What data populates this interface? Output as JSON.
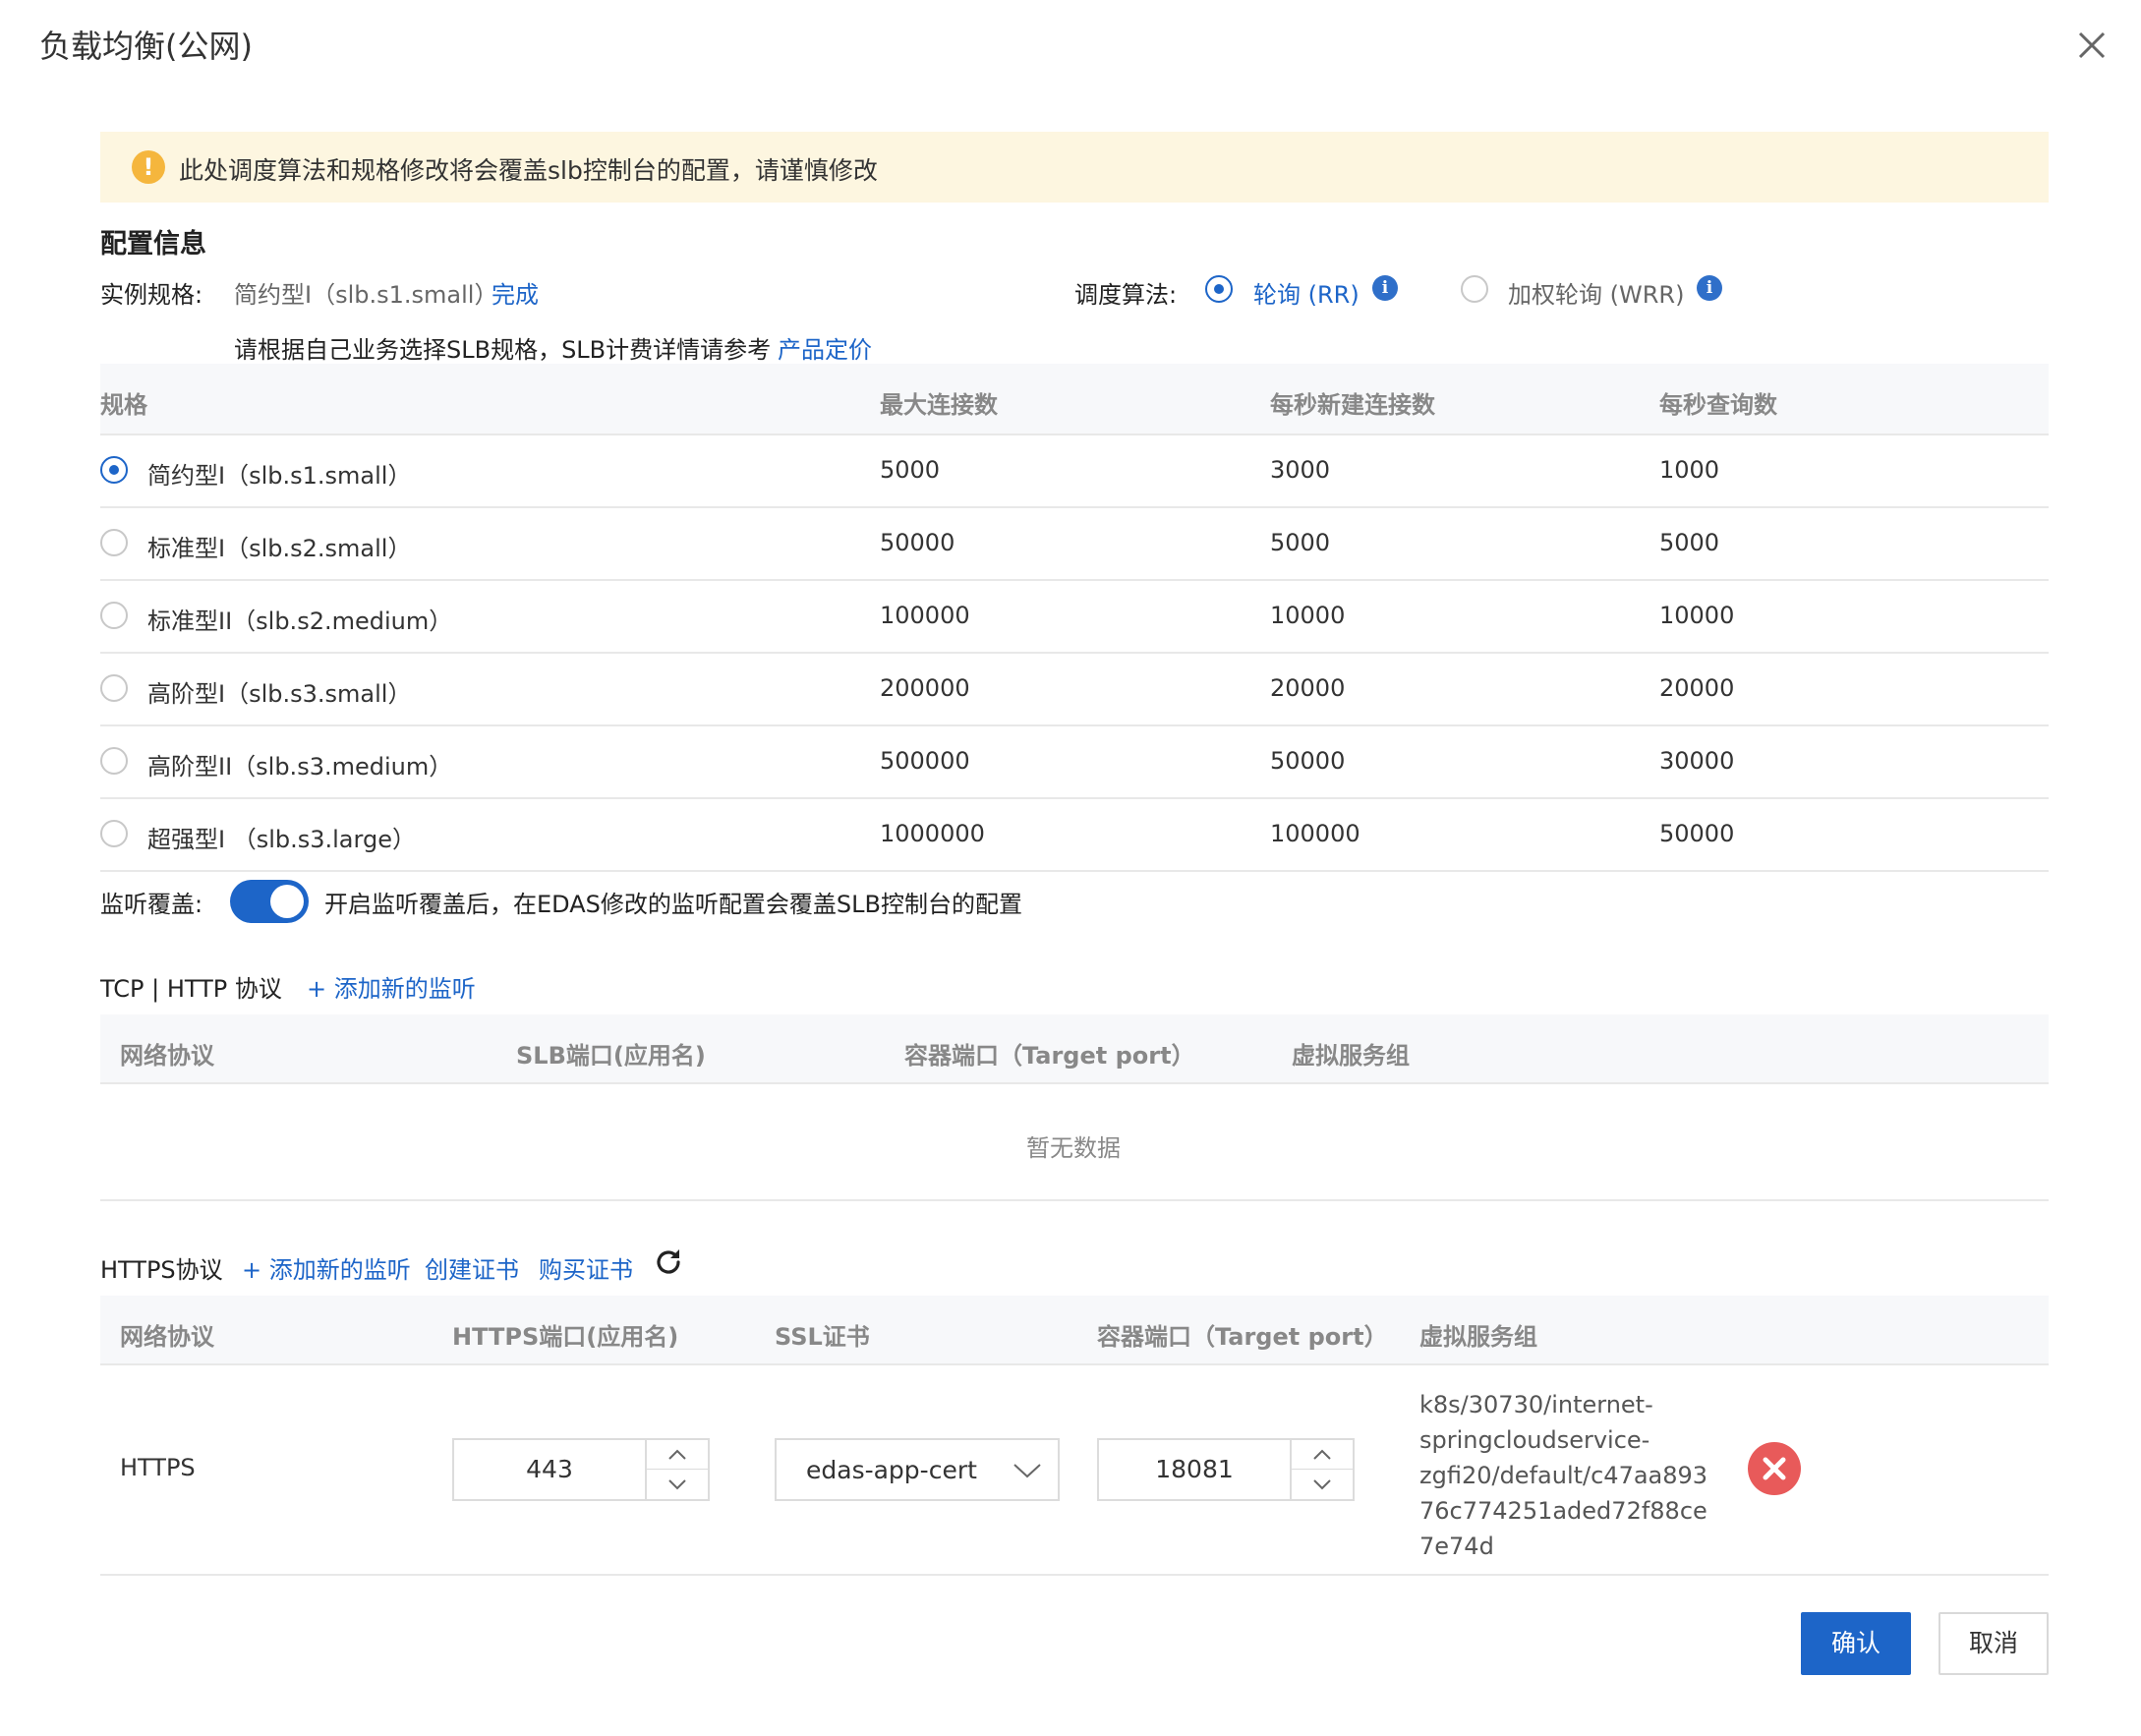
{
  "dialog": {
    "title": "负载均衡(公网)"
  },
  "warning": {
    "text": "此处调度算法和规格修改将会覆盖slb控制台的配置，请谨慎修改",
    "icon": "exclamation-icon"
  },
  "config": {
    "section_title": "配置信息",
    "spec_label": "实例规格:",
    "spec_value": "简约型I（slb.s1.small）",
    "spec_done": "完成",
    "hint_text": "请根据自己业务选择SLB规格，SLB计费详情请参考",
    "hint_link": "产品定价",
    "algo_label": "调度算法:",
    "algo_options": [
      {
        "label": "轮询 (RR)",
        "selected": true
      },
      {
        "label": "加权轮询 (WRR)",
        "selected": false
      }
    ]
  },
  "spec_table": {
    "headers": [
      "规格",
      "最大连接数",
      "每秒新建连接数",
      "每秒查询数"
    ],
    "rows": [
      {
        "name": "简约型I（slb.s1.small）",
        "max_conn": "5000",
        "new_conn": "3000",
        "qps": "1000",
        "selected": true
      },
      {
        "name": "标准型I（slb.s2.small）",
        "max_conn": "50000",
        "new_conn": "5000",
        "qps": "5000",
        "selected": false
      },
      {
        "name": "标准型II（slb.s2.medium）",
        "max_conn": "100000",
        "new_conn": "10000",
        "qps": "10000",
        "selected": false
      },
      {
        "name": "高阶型I（slb.s3.small）",
        "max_conn": "200000",
        "new_conn": "20000",
        "qps": "20000",
        "selected": false
      },
      {
        "name": "高阶型II（slb.s3.medium）",
        "max_conn": "500000",
        "new_conn": "50000",
        "qps": "30000",
        "selected": false
      },
      {
        "name": "超强型I （slb.s3.large）",
        "max_conn": "1000000",
        "new_conn": "100000",
        "qps": "50000",
        "selected": false
      }
    ]
  },
  "listen_override": {
    "label": "监听覆盖:",
    "enabled": true,
    "description": "开启监听覆盖后，在EDAS修改的监听配置会覆盖SLB控制台的配置"
  },
  "tcp_section": {
    "title": "TCP | HTTP 协议",
    "add_link": "+ 添加新的监听",
    "headers": [
      "网络协议",
      "SLB端口(应用名)",
      "容器端口（Target port）",
      "虚拟服务组"
    ],
    "empty_text": "暂无数据"
  },
  "https_section": {
    "title": "HTTPS协议",
    "add_link": "+ 添加新的监听",
    "create_cert": "创建证书",
    "buy_cert": "购买证书",
    "headers": [
      "网络协议",
      "HTTPS端口(应用名)",
      "SSL证书",
      "容器端口（Target port）",
      "虚拟服务组"
    ],
    "row": {
      "protocol": "HTTPS",
      "https_port": "443",
      "ssl_cert": "edas-app-cert",
      "target_port": "18081",
      "vgroup_lines": [
        "k8s/30730/internet-",
        "springcloudservice-",
        "zgfi20/default/c47aa893",
        "76c774251aded72f88ce",
        "7e74d"
      ]
    }
  },
  "footer": {
    "confirm": "确认",
    "cancel": "取消"
  },
  "colors": {
    "primary": "#1d65c8",
    "warning_bg": "#fdf6e0",
    "warning_icon": "#f5b63d",
    "danger": "#e85a5a"
  }
}
